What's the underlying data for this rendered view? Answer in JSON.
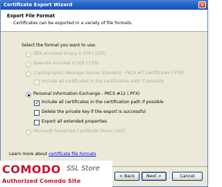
{
  "window": {
    "title": "Certificate Export Wizard",
    "close_glyph": "×"
  },
  "header": {
    "title": "Export File Format",
    "subtitle": "Certificates can be exported in a variety of file formats."
  },
  "prompt": "Select the format you want to use:",
  "options": [
    {
      "label": "DER encoded binary X.509 (.CER)",
      "selected": false,
      "enabled": false
    },
    {
      "label": "Base-64 encoded X.509 (.CER)",
      "selected": false,
      "enabled": false
    },
    {
      "label": "Cryptographic Message Syntax Standard - PKCS #7 Certificates (.P7B)",
      "selected": false,
      "enabled": false
    },
    {
      "label": "Personal Information Exchange - PKCS #12 (.PFX)",
      "selected": true,
      "enabled": true
    },
    {
      "label": "Microsoft Serialized Certificate Store (.SST)",
      "selected": false,
      "enabled": false
    }
  ],
  "p7b_checkbox": {
    "label": "Include all certificates in the certification path if possible",
    "checked": false,
    "enabled": false
  },
  "pfx_checkboxes": [
    {
      "label": "Include all certificates in the certification path if possible",
      "checked": true
    },
    {
      "label": "Delete the private key if the export is successful",
      "checked": false
    },
    {
      "label": "Export all extended properties",
      "checked": false
    }
  ],
  "learn_more": {
    "prefix": "Learn more about",
    "link": "certificate file formats"
  },
  "buttons": {
    "back": "< Back",
    "next": "Next >",
    "cancel": "Cancel"
  },
  "branding": {
    "logo": "COMODO",
    "logo_sub": "SSL Store",
    "tagline": "Authorized Comodo Site",
    "color": "#c8102e"
  }
}
